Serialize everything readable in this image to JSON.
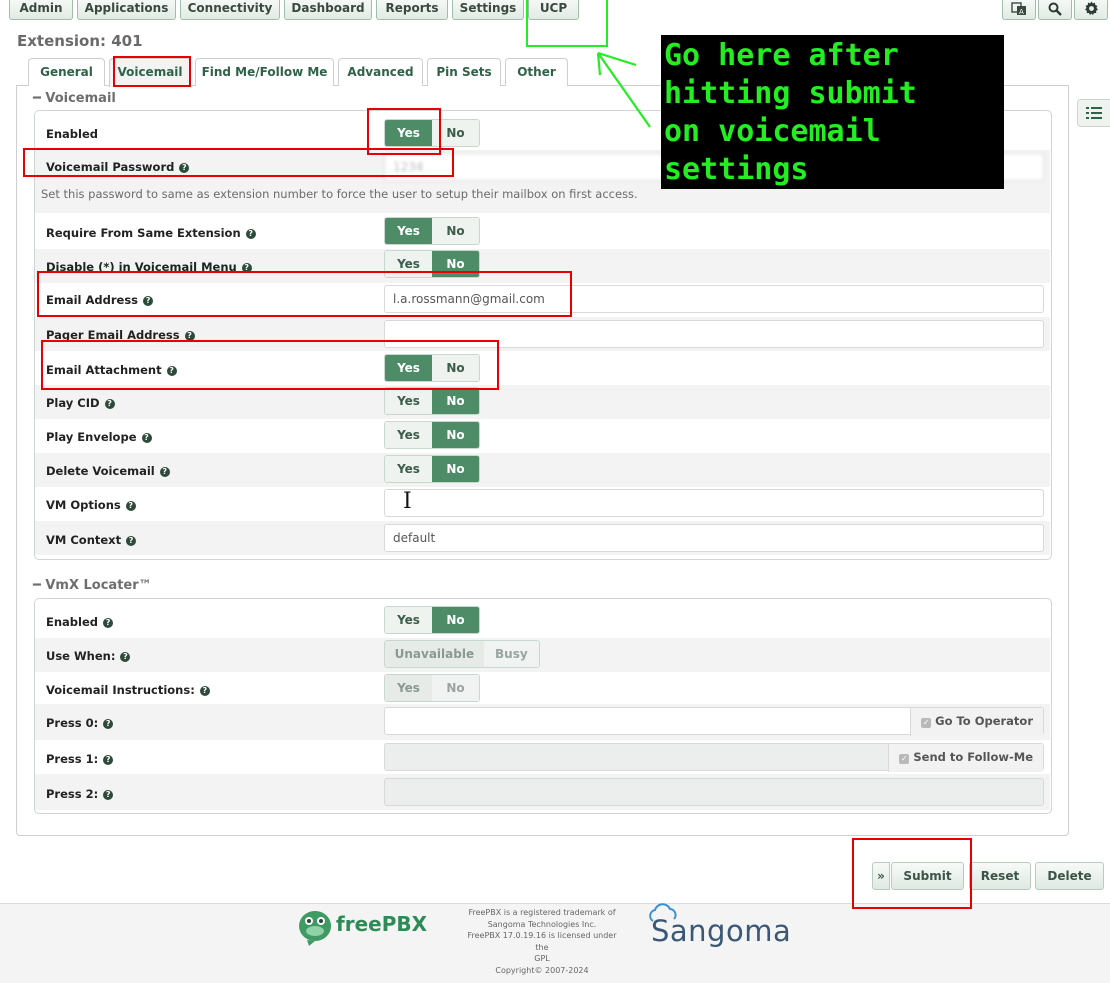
{
  "nav": {
    "items": [
      {
        "label": "Admin"
      },
      {
        "label": "Applications"
      },
      {
        "label": "Connectivity"
      },
      {
        "label": "Dashboard"
      },
      {
        "label": "Reports"
      },
      {
        "label": "Settings"
      },
      {
        "label": "UCP"
      }
    ],
    "icons": [
      "language-icon",
      "search-icon",
      "gear-icon"
    ]
  },
  "page": {
    "title": "Extension: 401"
  },
  "tabs": [
    "General",
    "Voicemail",
    "Find Me/Follow Me",
    "Advanced",
    "Pin Sets",
    "Other"
  ],
  "active_tab": "Voicemail",
  "annotation": {
    "callout": "Go here after\nhitting submit\non voicemail\nsettings",
    "colors": {
      "red": "#e60000",
      "green": "#22ee22"
    }
  },
  "voicemail": {
    "section_title": "Voicemail",
    "enabled": {
      "label": "Enabled",
      "yes": "Yes",
      "no": "No",
      "value": "Yes"
    },
    "password": {
      "label": "Voicemail Password",
      "value": "1234",
      "help": "Set this password to same as extension number to force the user to setup their mailbox on first access."
    },
    "require_same_ext": {
      "label": "Require From Same Extension",
      "yes": "Yes",
      "no": "No",
      "value": "Yes"
    },
    "disable_star": {
      "label": "Disable (*) in Voicemail Menu",
      "yes": "Yes",
      "no": "No",
      "value": "No"
    },
    "email": {
      "label": "Email Address",
      "value": "l.a.rossmann@gmail.com"
    },
    "pager_email": {
      "label": "Pager Email Address",
      "value": ""
    },
    "email_attachment": {
      "label": "Email Attachment",
      "yes": "Yes",
      "no": "No",
      "value": "Yes"
    },
    "play_cid": {
      "label": "Play CID",
      "yes": "Yes",
      "no": "No",
      "value": "No"
    },
    "play_envelope": {
      "label": "Play Envelope",
      "yes": "Yes",
      "no": "No",
      "value": "No"
    },
    "delete_voicemail": {
      "label": "Delete Voicemail",
      "yes": "Yes",
      "no": "No",
      "value": "No"
    },
    "vm_options": {
      "label": "VM Options",
      "value": ""
    },
    "vm_context": {
      "label": "VM Context",
      "value": "default"
    }
  },
  "vmx": {
    "section_title": "VmX Locater™",
    "enabled": {
      "label": "Enabled",
      "yes": "Yes",
      "no": "No",
      "value": "No"
    },
    "use_when": {
      "label": "Use When:",
      "opt1": "Unavailable",
      "opt2": "Busy"
    },
    "instructions": {
      "label": "Voicemail Instructions:",
      "yes": "Yes",
      "no": "No"
    },
    "press0": {
      "label": "Press 0:",
      "addon": "Go To Operator"
    },
    "press1": {
      "label": "Press 1:",
      "addon": "Send to Follow-Me"
    },
    "press2": {
      "label": "Press 2:"
    }
  },
  "actions": {
    "expand": "»",
    "submit": "Submit",
    "reset": "Reset",
    "delete": "Delete"
  },
  "footer": {
    "freepbx_logo": "freePBX",
    "sangoma_logo": "Sangoma",
    "lines": [
      "FreePBX is a registered trademark of",
      "Sangoma Technologies Inc.",
      "FreePBX 17.0.19.16 is licensed under the",
      "GPL",
      "Copyright© 2007-2024"
    ]
  }
}
